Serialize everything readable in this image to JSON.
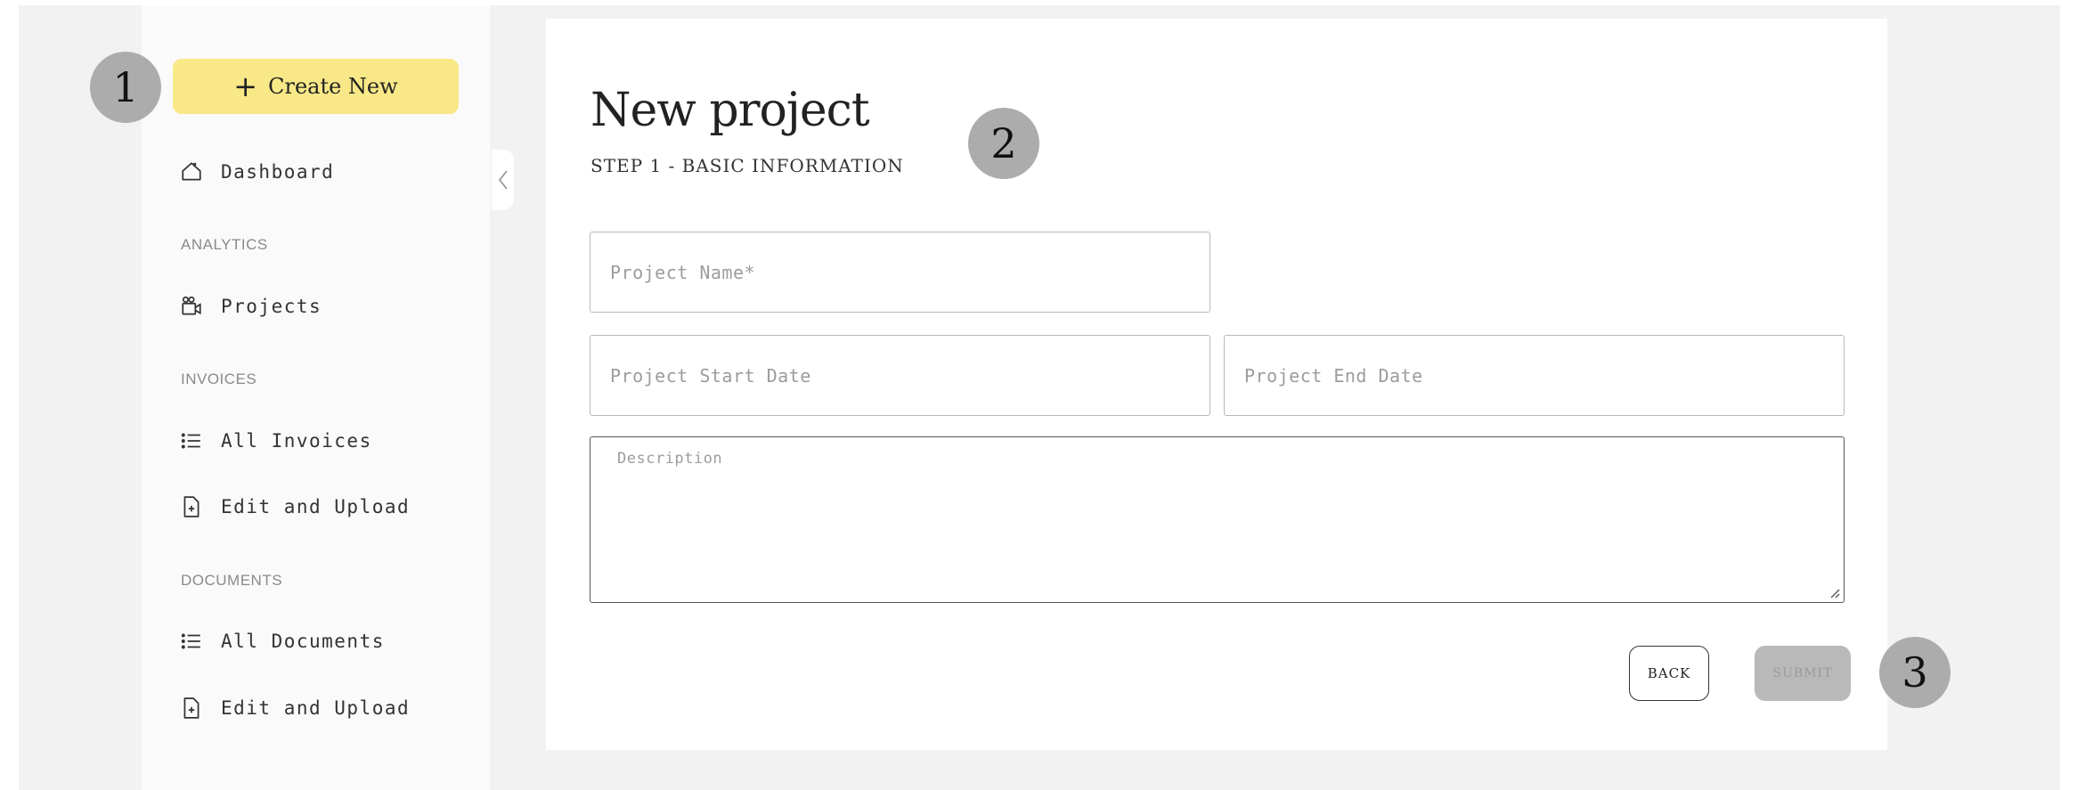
{
  "sidebar": {
    "create_label": "Create New",
    "dashboard": "Dashboard",
    "sections": {
      "analytics": "ANALYTICS",
      "invoices": "INVOICES",
      "documents": "DOCUMENTS"
    },
    "items": {
      "projects": "Projects",
      "all_invoices": "All Invoices",
      "invoice_upload": "Edit and Upload",
      "all_documents": "All Documents",
      "document_upload": "Edit and Upload"
    }
  },
  "form": {
    "title": "New project",
    "subtitle": "STEP 1 - BASIC INFORMATION",
    "project_name_placeholder": "Project Name*",
    "start_date_placeholder": "Project Start Date",
    "end_date_placeholder": "Project End Date",
    "description_placeholder": "Description",
    "back_label": "BACK",
    "submit_label": "SUBMIT"
  },
  "markers": [
    "1",
    "2",
    "3"
  ],
  "colors": {
    "accent": "#f9e887",
    "marker": "#acacac",
    "submit_disabled": "#b9b9b9"
  }
}
